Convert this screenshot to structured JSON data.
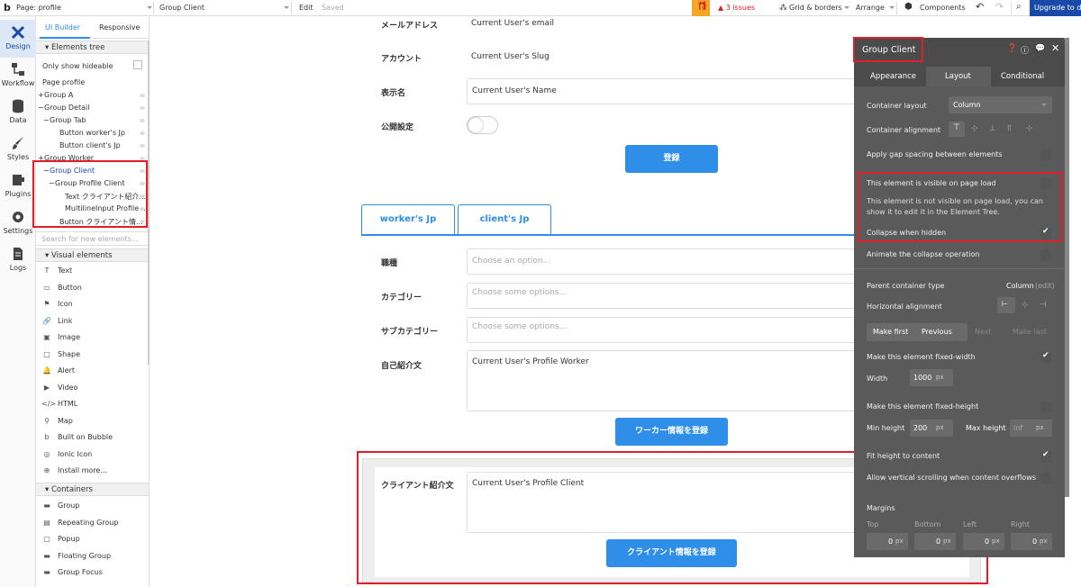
{
  "topbar": {
    "page_label": "Page: profile",
    "element_select": "Group Client",
    "edit": "Edit",
    "saved": "Saved",
    "issues": "3 issues",
    "grid": "Grid & borders",
    "arrange": "Arrange",
    "components": "Components",
    "upgrade": "Upgrade to d"
  },
  "nav": [
    {
      "label": "Design",
      "icon": "design-icon"
    },
    {
      "label": "Workflow",
      "icon": "workflow-icon"
    },
    {
      "label": "Data",
      "icon": "data-icon"
    },
    {
      "label": "Styles",
      "icon": "styles-icon"
    },
    {
      "label": "Plugins",
      "icon": "plugins-icon"
    },
    {
      "label": "Settings",
      "icon": "settings-icon"
    },
    {
      "label": "Logs",
      "icon": "logs-icon"
    }
  ],
  "sidebar": {
    "tab_ui": "UI Builder",
    "tab_responsive": "Responsive",
    "elements_tree": "Elements tree",
    "only_show_hideable": "Only show hideable",
    "tree": [
      {
        "label": "Page profile",
        "prefix": ""
      },
      {
        "label": "Group A",
        "prefix": "+"
      },
      {
        "label": "Group Detail",
        "prefix": "−"
      },
      {
        "label": "Group Tab",
        "prefix": "−"
      },
      {
        "label": "Button worker's Jp",
        "prefix": ""
      },
      {
        "label": "Button client's Jp",
        "prefix": ""
      },
      {
        "label": "Group Worker",
        "prefix": "+"
      },
      {
        "label": "Group Client",
        "prefix": "−"
      },
      {
        "label": "Group Profile Client",
        "prefix": "−"
      },
      {
        "label": "Text クライアント紹介...",
        "prefix": ""
      },
      {
        "label": "MultilineInput Profile ...",
        "prefix": ""
      },
      {
        "label": "Button クライアント情...",
        "prefix": ""
      }
    ],
    "search_placeholder": "Search for new elements...",
    "visual_elements": "Visual elements",
    "visual_items": [
      {
        "label": "Text",
        "icon": "text-icon",
        "glyph": "T"
      },
      {
        "label": "Button",
        "icon": "button-icon",
        "glyph": "▭"
      },
      {
        "label": "Icon",
        "icon": "flag-icon",
        "glyph": "⚑"
      },
      {
        "label": "Link",
        "icon": "link-icon",
        "glyph": "🔗"
      },
      {
        "label": "Image",
        "icon": "image-icon",
        "glyph": "▣"
      },
      {
        "label": "Shape",
        "icon": "shape-icon",
        "glyph": "□"
      },
      {
        "label": "Alert",
        "icon": "bell-icon",
        "glyph": "🔔"
      },
      {
        "label": "Video",
        "icon": "video-icon",
        "glyph": "▶"
      },
      {
        "label": "HTML",
        "icon": "code-icon",
        "glyph": "</>"
      },
      {
        "label": "Map",
        "icon": "map-pin-icon",
        "glyph": "⚲"
      },
      {
        "label": "Built on Bubble",
        "icon": "bubble-logo-icon",
        "glyph": "b"
      },
      {
        "label": "Ionic Icon",
        "icon": "ionic-icon",
        "glyph": "◎"
      },
      {
        "label": "Install more...",
        "icon": "plus-circle-icon",
        "glyph": "⊕"
      }
    ],
    "containers": "Containers",
    "container_items": [
      {
        "label": "Group",
        "icon": "folder-icon",
        "glyph": "▬"
      },
      {
        "label": "Repeating Group",
        "icon": "repeating-group-icon",
        "glyph": "▤"
      },
      {
        "label": "Popup",
        "icon": "popup-icon",
        "glyph": "▢"
      },
      {
        "label": "Floating Group",
        "icon": "floating-group-icon",
        "glyph": "▬"
      },
      {
        "label": "Group Focus",
        "icon": "group-focus-icon",
        "glyph": "▬"
      }
    ]
  },
  "canvas": {
    "email_label": "メールアドレス",
    "email_value": "Current User's email",
    "account_label": "アカウント",
    "account_value": "Current User's Slug",
    "name_label": "表示名",
    "name_value": "Current User's Name",
    "public_label": "公開設定",
    "register_btn": "登録",
    "tab_worker": "worker's Jp",
    "tab_client": "client's Jp",
    "job_label": "職種",
    "job_placeholder": "Choose an option...",
    "category_label": "カテゴリー",
    "category_placeholder": "Choose some options...",
    "subcategory_label": "サブカテゴリー",
    "subcategory_placeholder": "Choose some options...",
    "intro_label": "自己紹介文",
    "intro_value": "Current User's Profile Worker",
    "worker_btn": "ワーカー情報を登録",
    "client_intro_label": "クライアント紹介文",
    "client_intro_value": "Current User's Profile Client",
    "client_btn": "クライアント情報を登録"
  },
  "panel": {
    "title": "Group Client",
    "tabs": [
      "Appearance",
      "Layout",
      "Conditional"
    ],
    "container_layout_label": "Container layout",
    "container_layout_value": "Column",
    "container_alignment_label": "Container alignment",
    "gap_spacing": "Apply gap spacing between elements",
    "visible_on_load": "This element is visible on page load",
    "visible_note": "This element is not visible on page load, you can show it to edit it in the Element Tree.",
    "collapse_hidden": "Collapse when hidden",
    "animate_collapse": "Animate the collapse operation",
    "parent_type_label": "Parent container type",
    "parent_type_value": "Column",
    "parent_type_edit": "(edit)",
    "horizontal_alignment": "Horizontal alignment",
    "make_first": "Make first",
    "previous": "Previous",
    "next": "Next",
    "make_last": "Make last",
    "fixed_width": "Make this element fixed-width",
    "width_label": "Width",
    "width_value": "1000",
    "width_unit": "px",
    "fixed_height": "Make this element fixed-height",
    "min_height_label": "Min height",
    "min_height_value": "200",
    "min_height_unit": "px",
    "max_height_label": "Max height",
    "max_height_value": "inf",
    "max_height_unit": "px",
    "fit_height": "Fit height to content",
    "vertical_scroll": "Allow vertical scrolling when content overflows",
    "margins": "Margins",
    "margin_labels": [
      "Top",
      "Bottom",
      "Left",
      "Right"
    ],
    "margin_values": [
      "0",
      "0",
      "0",
      "0"
    ],
    "margin_unit": "px"
  },
  "colors": {
    "accent": "#2e8ee8",
    "highlight_red": "#e01f2b",
    "panel_bg": "#4b4b4b",
    "upgrade_bg": "#1a4aa8",
    "gift_orange": "#f5a623"
  }
}
